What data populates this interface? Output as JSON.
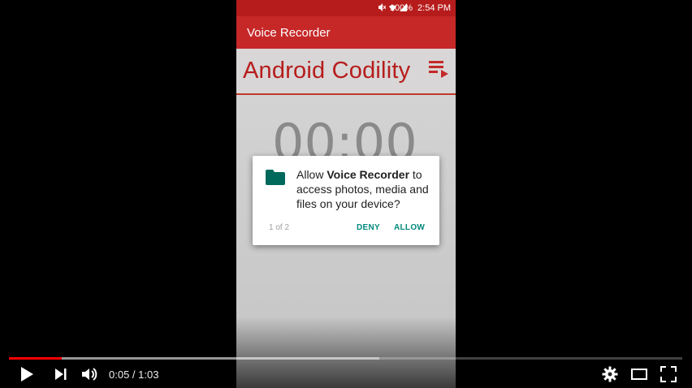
{
  "phone": {
    "status_bar": {
      "battery": "100%",
      "time": "2:54 PM"
    },
    "app_bar": {
      "title": "Voice Recorder"
    },
    "header": {
      "brand": "Android Codility",
      "icon": "playlist-play-icon"
    },
    "timer": "00:00",
    "permission_dialog": {
      "icon": "folder-icon",
      "prefix": "Allow ",
      "app_name": "Voice Recorder",
      "suffix": " to access photos, media and files on your device?",
      "counter": "1 of 2",
      "deny_label": "DENY",
      "allow_label": "ALLOW"
    },
    "colors": {
      "primary": "#c62828",
      "accent": "#00897b"
    }
  },
  "player": {
    "current_time": "0:05",
    "duration": "1:03",
    "time_display": "0:05 / 1:03",
    "played_fraction": 0.079,
    "buffered_fraction": 0.55,
    "controls": [
      "play-icon",
      "next-icon",
      "volume-icon",
      "settings-icon",
      "theater-mode-icon",
      "fullscreen-icon"
    ]
  }
}
